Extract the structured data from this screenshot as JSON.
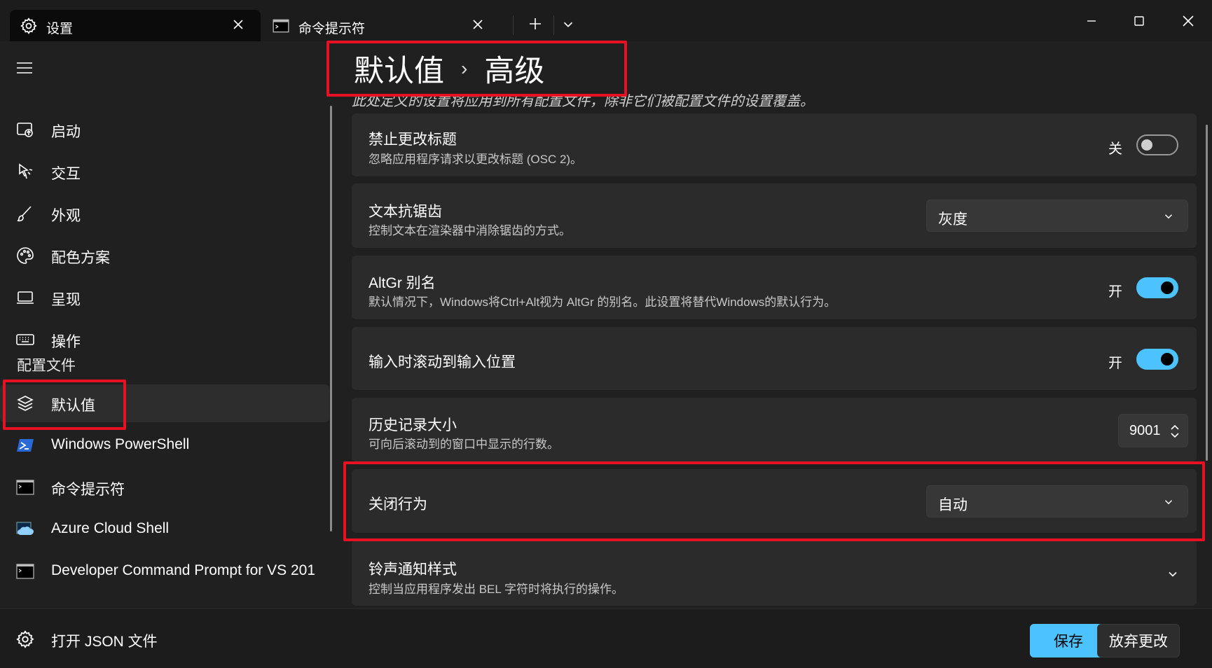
{
  "tabs": [
    {
      "label": "设置",
      "icon": "gear-icon",
      "active": true
    },
    {
      "label": "命令提示符",
      "icon": "terminal-icon",
      "active": false
    }
  ],
  "sidebar": {
    "items": [
      {
        "label": "启动",
        "icon": "launch-icon"
      },
      {
        "label": "交互",
        "icon": "pointer-icon"
      },
      {
        "label": "外观",
        "icon": "brush-icon"
      },
      {
        "label": "配色方案",
        "icon": "palette-icon"
      },
      {
        "label": "呈现",
        "icon": "monitor-icon"
      },
      {
        "label": "操作",
        "icon": "keyboard-icon"
      }
    ],
    "section_label": "配置文件",
    "profiles": [
      {
        "label": "默认值",
        "icon": "layers-icon",
        "selected": true
      },
      {
        "label": "Windows PowerShell",
        "icon": "powershell-icon"
      },
      {
        "label": "命令提示符",
        "icon": "terminal-icon"
      },
      {
        "label": "Azure Cloud Shell",
        "icon": "cloud-icon"
      },
      {
        "label": "Developer Command Prompt for VS 201",
        "icon": "terminal-icon"
      }
    ],
    "open_json": "打开 JSON 文件"
  },
  "breadcrumb": {
    "parent": "默认值",
    "separator": "›",
    "current": "高级"
  },
  "subtitle": "此处定义的设置将应用到所有配置文件，除非它们被配置文件的设置覆盖。",
  "settings": [
    {
      "title": "禁止更改标题",
      "desc": "忽略应用程序请求以更改标题 (OSC 2)。",
      "state": "关"
    },
    {
      "title": "文本抗锯齿",
      "desc": "控制文本在渲染器中消除锯齿的方式。",
      "value": "灰度"
    },
    {
      "title": "AltGr 别名",
      "desc": "默认情况下，Windows将Ctrl+Alt视为 AltGr 的别名。此设置将替代Windows的默认行为。",
      "state": "开"
    },
    {
      "title": "输入时滚动到输入位置",
      "state": "开"
    },
    {
      "title": "历史记录大小",
      "desc": "可向后滚动到的窗口中显示的行数。",
      "value": "9001"
    },
    {
      "title": "关闭行为",
      "value": "自动"
    },
    {
      "title": "铃声通知样式",
      "desc": "控制当应用程序发出 BEL 字符时将执行的操作。"
    }
  ],
  "buttons": {
    "save": "保存",
    "discard": "放弃更改"
  },
  "colors": {
    "accent": "#4cc2ff",
    "highlight": "#e81123"
  }
}
